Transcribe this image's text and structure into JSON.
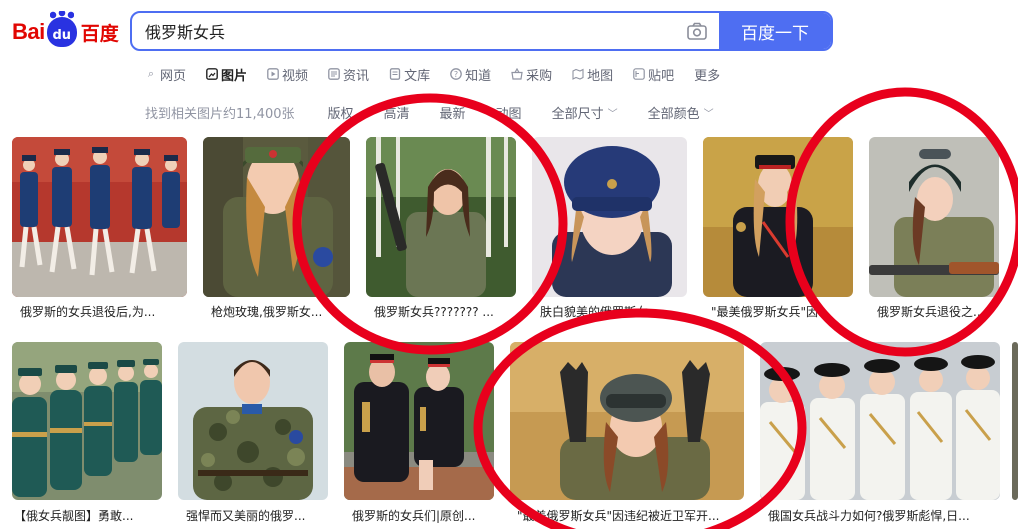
{
  "logo": {
    "bai": "Bai",
    "du": "du",
    "cn": "百度"
  },
  "search": {
    "query": "俄罗斯女兵",
    "button": "百度一下"
  },
  "tabs": [
    {
      "label": "网页",
      "icon": "search-icon"
    },
    {
      "label": "图片",
      "icon": "image-icon"
    },
    {
      "label": "视频",
      "icon": "video-icon"
    },
    {
      "label": "资讯",
      "icon": "news-icon"
    },
    {
      "label": "文库",
      "icon": "library-icon"
    },
    {
      "label": "知道",
      "icon": "question-icon"
    },
    {
      "label": "采购",
      "icon": "basket-icon"
    },
    {
      "label": "地图",
      "icon": "map-icon"
    },
    {
      "label": "贴吧",
      "icon": "tieba-icon"
    },
    {
      "label": "更多",
      "icon": ""
    }
  ],
  "filters": {
    "count": "找到相关图片约11,400张",
    "items": [
      "高清",
      "最新",
      "动图",
      "全部尺寸",
      "全部颜色"
    ],
    "hd_label": "高清",
    "res_label": "版权"
  },
  "row1": [
    {
      "caption": "俄罗斯的女兵退役后,为..."
    },
    {
      "caption": "枪炮玫瑰,俄罗斯女..."
    },
    {
      "caption": "俄罗斯女兵??????? ..."
    },
    {
      "caption": "肤白貌美的俄罗斯女..."
    },
    {
      "caption": "\"最美俄罗斯女兵\"因..."
    },
    {
      "caption": "俄罗斯女兵退役之..."
    }
  ],
  "row2": [
    {
      "caption": "【俄女兵靓图】勇敢..."
    },
    {
      "caption": "强悍而又美丽的俄罗..."
    },
    {
      "caption": "俄罗斯的女兵们|原创..."
    },
    {
      "caption": "\"最美俄罗斯女兵\"因违纪被近卫军开..."
    },
    {
      "caption": "俄国女兵战斗力如何?俄罗斯彪悍,日..."
    }
  ],
  "colors": {
    "accent": "#4e6ef2",
    "logo_red": "#e10602",
    "logo_blue": "#2932e1",
    "circle_red": "#e8001c"
  }
}
